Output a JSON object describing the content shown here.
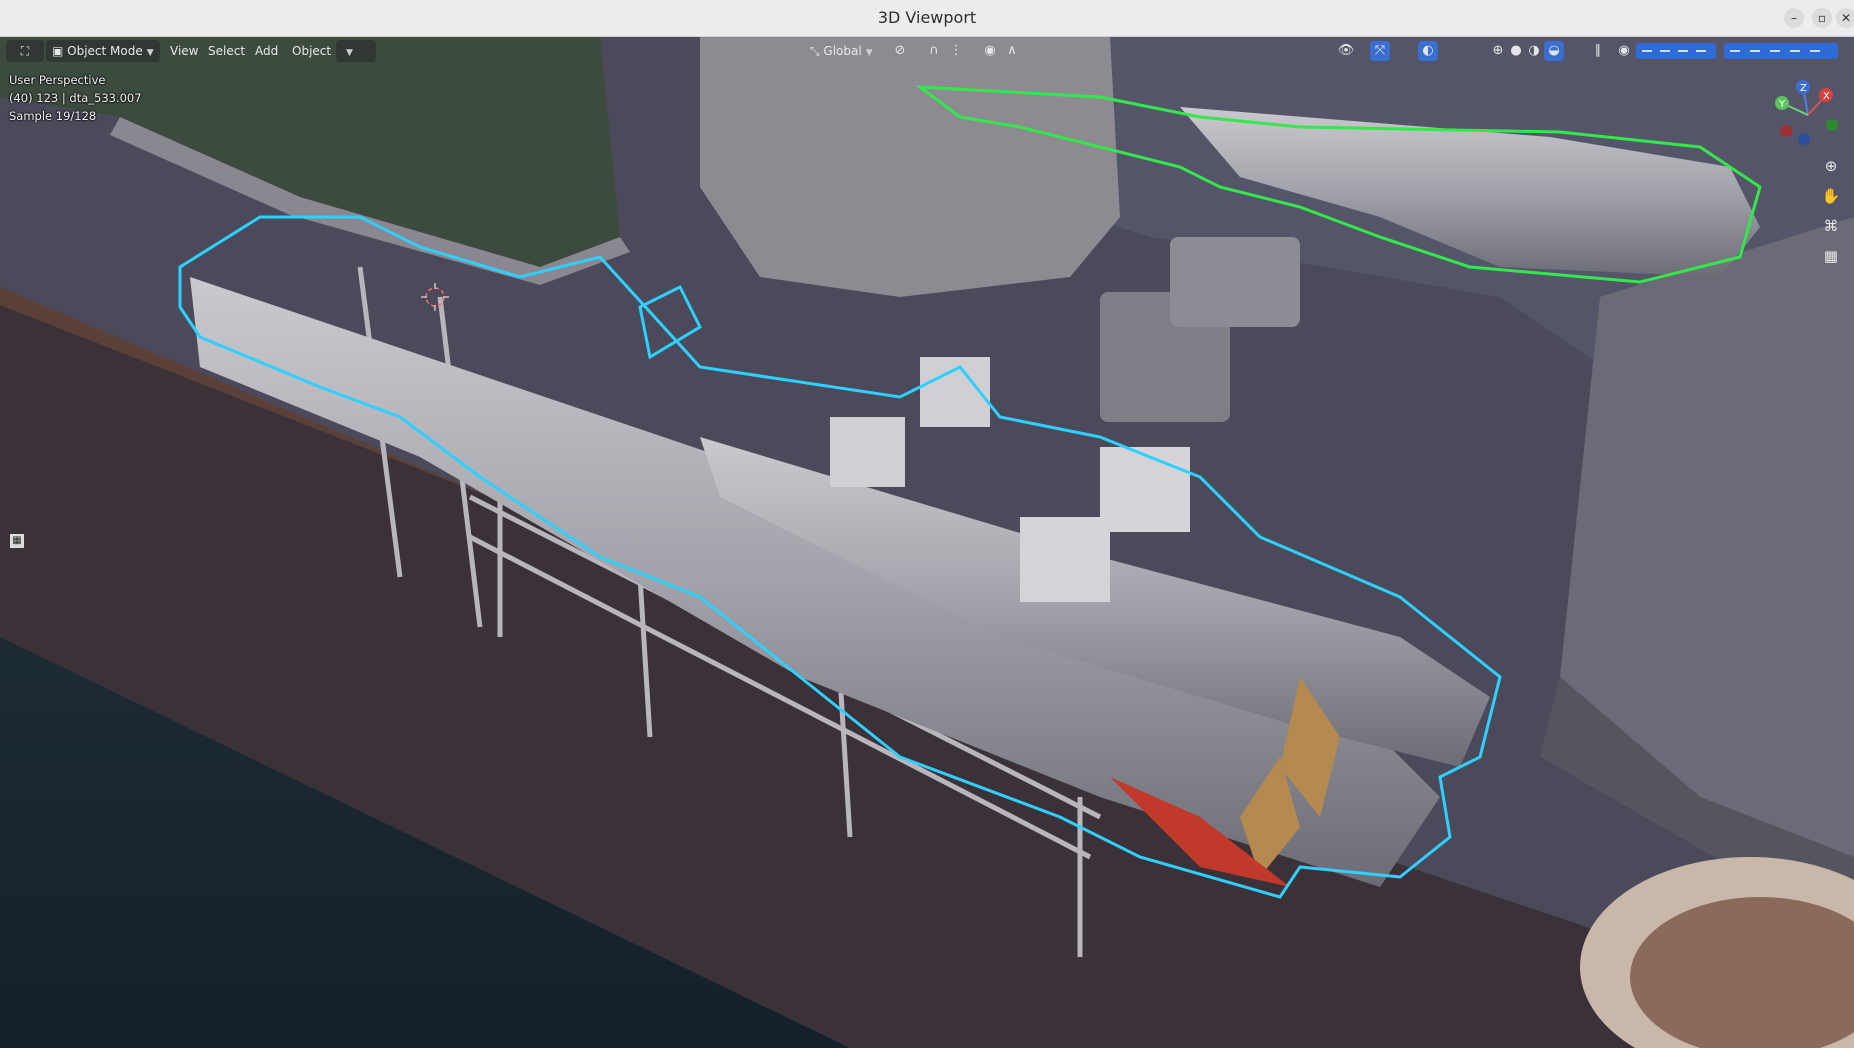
{
  "window": {
    "title": "3D Viewport",
    "minimize_glyph": "–",
    "maximize_glyph": "▫",
    "close_glyph": "✕"
  },
  "header": {
    "editor_type_glyph": "⛶",
    "mode": "Object Mode",
    "menus": [
      "View",
      "Select",
      "Add",
      "Object"
    ],
    "orientation": "Global",
    "pause_glyph": "∥",
    "eye_glyph": "◉"
  },
  "overlay": {
    "perspective": "User Perspective",
    "object_info": "(40) 123 | dta_533.007",
    "sample": "Sample 19/128"
  },
  "gizmo": {
    "x": "X",
    "y": "Y",
    "z": "Z"
  },
  "nav": {
    "zoom_glyph": "⊕",
    "pan_glyph": "✋",
    "camera_glyph": "⌘",
    "ortho_glyph": "▦"
  },
  "colors": {
    "selection_active": "#2fd0ff",
    "selection_other": "#33e84a",
    "deck": "#4a4a5a",
    "water": "#1c2a33",
    "accent_blue": "#2f6bd6"
  }
}
